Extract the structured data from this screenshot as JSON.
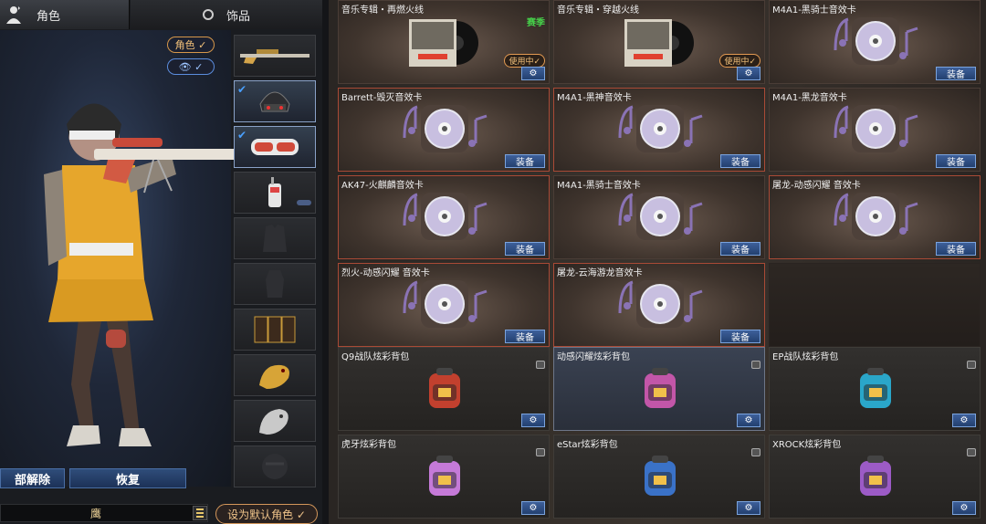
{
  "tabs": {
    "role": "角色",
    "accessory": "饰品"
  },
  "pills": {
    "role": "角色 ✓",
    "eye": "👁 ✓"
  },
  "buttons": {
    "remove_all": "部解除",
    "restore": "恢复",
    "set_default": "设为默认角色 ✓"
  },
  "character": {
    "name": "鹰"
  },
  "slots": [
    {
      "name": "sniper-rifle",
      "checked": false
    },
    {
      "name": "helmet",
      "checked": true
    },
    {
      "name": "goggles",
      "checked": true
    },
    {
      "name": "walkie-talkie",
      "checked": false
    },
    {
      "name": "empty-vest",
      "checked": false
    },
    {
      "name": "empty-body",
      "checked": false
    },
    {
      "name": "ammo-pouch",
      "checked": false
    },
    {
      "name": "gold-dragon-pendant",
      "checked": false
    },
    {
      "name": "silver-horse-pendant",
      "checked": false
    },
    {
      "name": "empty-round",
      "checked": false
    }
  ],
  "cards": [
    {
      "title": "音乐专辑・再燃火线",
      "kind": "album",
      "badge": "赛季",
      "inuse": "使用中✓",
      "btn": "⚙"
    },
    {
      "title": "音乐专辑・穿越火线",
      "kind": "album",
      "inuse": "使用中✓",
      "btn": "⚙"
    },
    {
      "title": "M4A1-黑骑士音效卡",
      "kind": "disc",
      "btn": "装备"
    },
    {
      "title": "Barrett-毁灭音效卡",
      "kind": "disc",
      "btn": "装备",
      "hl": true
    },
    {
      "title": "M4A1-黑神音效卡",
      "kind": "disc",
      "btn": "装备",
      "hl": true
    },
    {
      "title": "M4A1-黑龙音效卡",
      "kind": "disc",
      "btn": "装备"
    },
    {
      "title": "AK47-火麒麟音效卡",
      "kind": "disc",
      "btn": "装备",
      "hl": true
    },
    {
      "title": "M4A1-黑骑士音效卡",
      "kind": "disc",
      "btn": "装备"
    },
    {
      "title": "屠龙-动感闪耀 音效卡",
      "kind": "disc",
      "btn": "装备",
      "hl": true
    },
    {
      "title": "烈火-动感闪耀 音效卡",
      "kind": "disc",
      "btn": "装备",
      "hl": true
    },
    {
      "title": "屠龙-云海游龙音效卡",
      "kind": "disc",
      "btn": "装备",
      "hl": true
    },
    {
      "title": "",
      "kind": "empty"
    },
    {
      "title": "Q9战队炫彩背包",
      "kind": "bag",
      "color": "#c2402e",
      "btn": "⚙"
    },
    {
      "title": "动感闪耀炫彩背包",
      "kind": "bag",
      "color": "#c256a8",
      "btn": "⚙",
      "sel": true
    },
    {
      "title": "EP战队炫彩背包",
      "kind": "bag",
      "color": "#2aa6c9",
      "btn": "⚙"
    },
    {
      "title": "虎牙炫彩背包",
      "kind": "bag",
      "color": "#c57ad8",
      "btn": "⚙"
    },
    {
      "title": "eStar炫彩背包",
      "kind": "bag",
      "color": "#3a72c8",
      "btn": "⚙"
    },
    {
      "title": "XROCK炫彩背包",
      "kind": "bag",
      "color": "#9c5bc6",
      "btn": "⚙"
    }
  ]
}
